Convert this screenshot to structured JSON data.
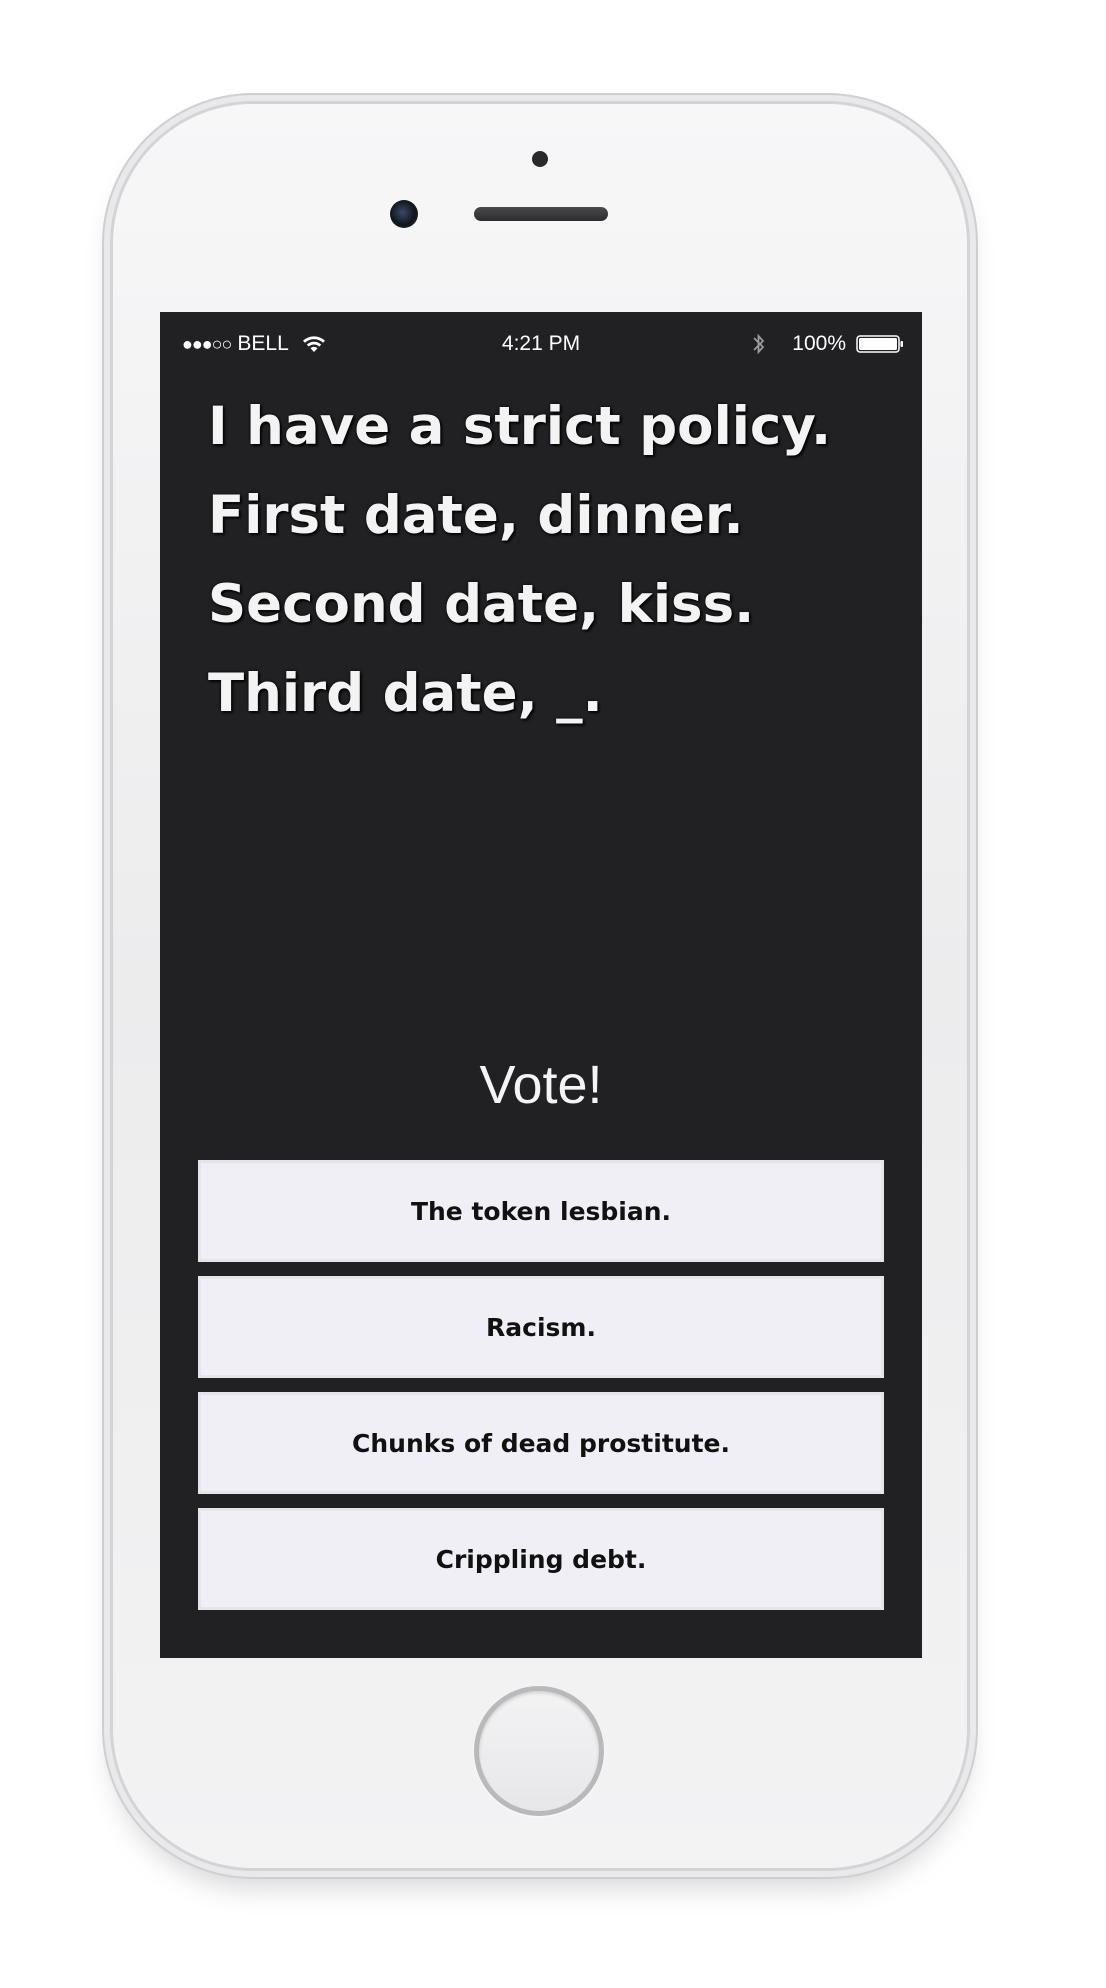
{
  "status_bar": {
    "signal": "●●●○○",
    "carrier": "BELL",
    "time": "4:21 PM",
    "battery": "100%"
  },
  "prompt": {
    "text": "I have a strict policy. First date, dinner. Second date, kiss. Third date, _."
  },
  "vote": {
    "title": "Vote!"
  },
  "answers": [
    {
      "label": "The token lesbian."
    },
    {
      "label": "Racism."
    },
    {
      "label": "Chunks of dead prostitute."
    },
    {
      "label": "Crippling debt."
    }
  ],
  "icons": {
    "wifi": "wifi-icon",
    "bluetooth": "bluetooth-icon",
    "battery": "battery-icon"
  },
  "colors": {
    "screen_background": "#212124",
    "answer_background": "#f0eff5",
    "text_light": "#f3f3f3"
  }
}
